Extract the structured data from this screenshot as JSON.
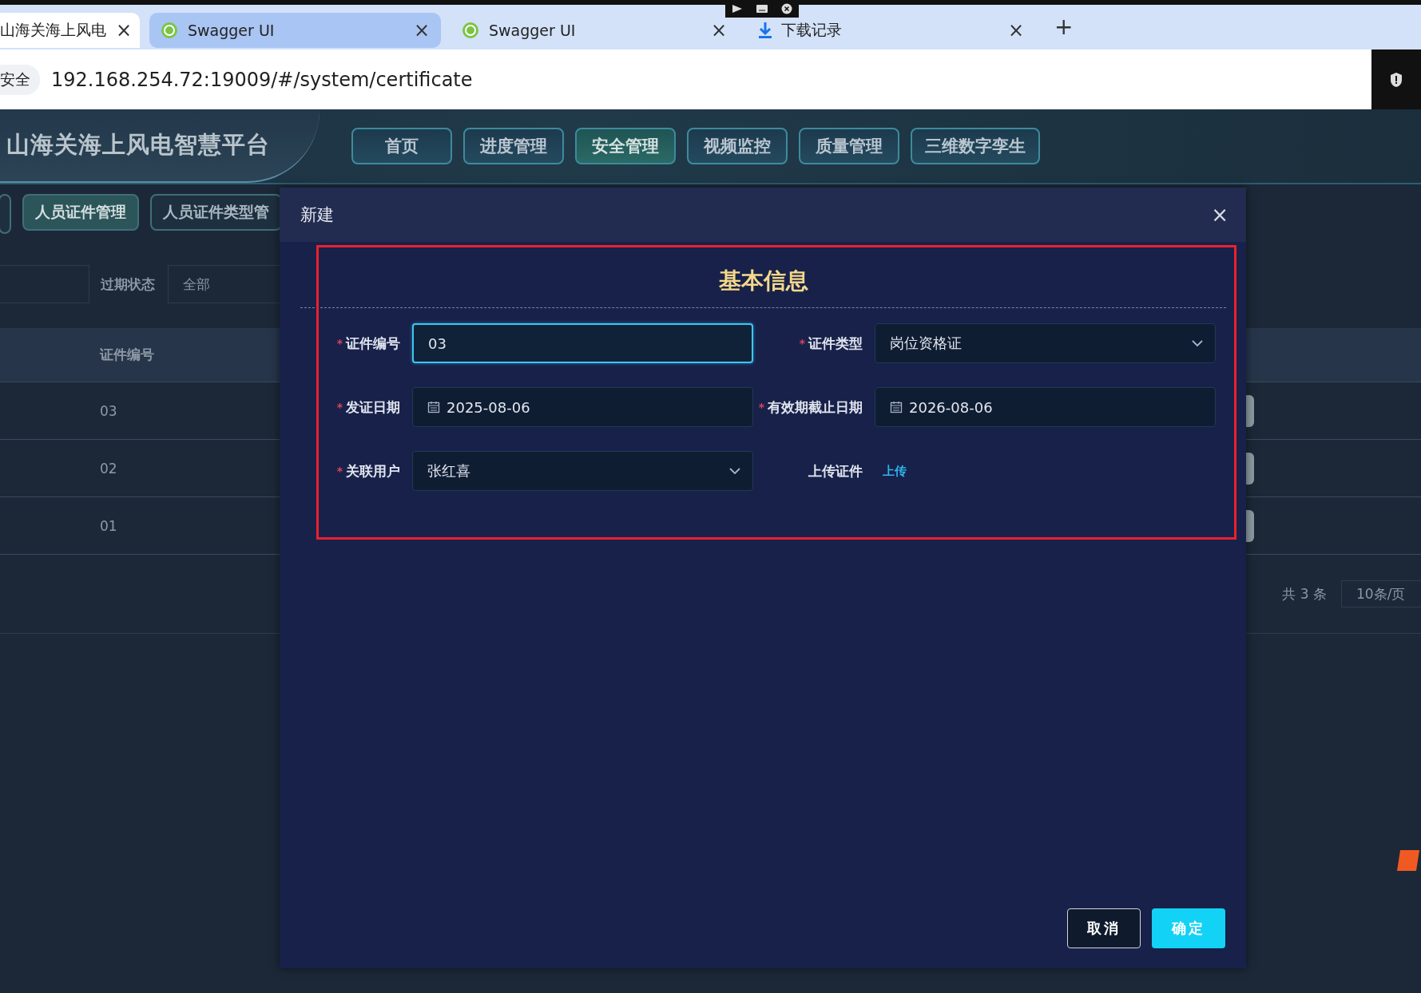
{
  "browser": {
    "tabs": [
      {
        "title": "山海关海上风电",
        "kind": "page",
        "selected": true
      },
      {
        "title": "Swagger UI",
        "kind": "swagger",
        "selected": false
      },
      {
        "title": "Swagger UI",
        "kind": "swagger",
        "selected": false
      },
      {
        "title": "下载记录",
        "kind": "download",
        "selected": false
      }
    ],
    "new_tab": "+",
    "close": "×",
    "security_badge": "安全",
    "url": "192.168.254.72:19009/#/system/certificate"
  },
  "app": {
    "title": "山海关海上风电智慧平台",
    "nav": [
      {
        "label": "首页",
        "selected": false
      },
      {
        "label": "进度管理",
        "selected": false
      },
      {
        "label": "安全管理",
        "selected": true
      },
      {
        "label": "视频监控",
        "selected": false
      },
      {
        "label": "质量管理",
        "selected": false
      },
      {
        "label": "三维数字孪生",
        "selected": false
      }
    ],
    "subtabs": [
      {
        "label": "人员证件管理",
        "selected": true
      },
      {
        "label": "人员证件类型管",
        "selected": false
      }
    ],
    "filter": {
      "label": "过期状态",
      "value": "全部"
    },
    "table": {
      "columns": [
        "证件编号"
      ],
      "rows": [
        [
          "03"
        ],
        [
          "02"
        ],
        [
          "01"
        ]
      ]
    },
    "pagination": {
      "total": "共 3 条",
      "page_size": "10条/页"
    }
  },
  "dialog": {
    "title": "新建",
    "close": "×",
    "section_title": "基本信息",
    "fields": [
      {
        "label": "证件编号",
        "required": true,
        "kind": "text",
        "value": "03",
        "focused": true
      },
      {
        "label": "证件类型",
        "required": true,
        "kind": "select",
        "value": "岗位资格证",
        "focused": false
      },
      {
        "label": "发证日期",
        "required": true,
        "kind": "date",
        "value": "2025-08-06",
        "focused": false
      },
      {
        "label": "有效期截止日期",
        "required": true,
        "kind": "date",
        "value": "2026-08-06",
        "focused": false
      },
      {
        "label": "关联用户",
        "required": true,
        "kind": "select",
        "value": "张红喜",
        "focused": false
      },
      {
        "label": "上传证件",
        "kind": "upload",
        "value": "上传"
      }
    ],
    "required_mark": "*",
    "buttons": [
      {
        "label": "取消",
        "kind": "secondary"
      },
      {
        "label": "确定",
        "kind": "primary"
      }
    ]
  }
}
